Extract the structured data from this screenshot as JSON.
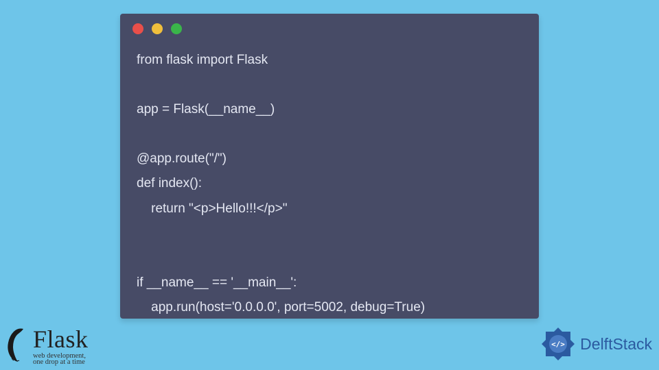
{
  "code": {
    "lines": [
      "from flask import Flask",
      "",
      "app = Flask(__name__)",
      "",
      "@app.route(\"/\")",
      "def index():",
      "    return \"<p>Hello!!!</p>\"",
      "",
      "",
      "if __name__ == '__main__':",
      "    app.run(host='0.0.0.0', port=5002, debug=True)"
    ]
  },
  "flask_logo": {
    "title": "Flask",
    "subtitle_line1": "web development,",
    "subtitle_line2": "one drop at a time"
  },
  "delft_logo": {
    "text": "DelftStack"
  }
}
